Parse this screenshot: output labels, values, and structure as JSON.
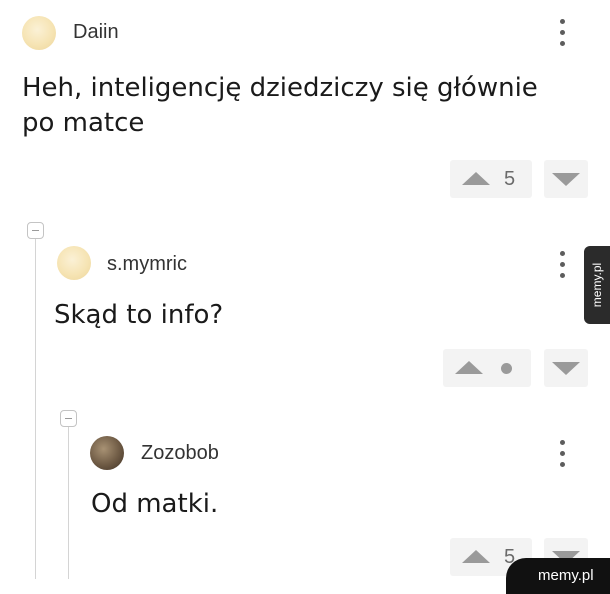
{
  "comments": [
    {
      "username": "Daiin",
      "avatar": "avatar-light",
      "text_lines": [
        "Heh, inteligencję dziedziczy się głównie",
        "po matce"
      ],
      "score": "5"
    },
    {
      "username": "s.mymric",
      "avatar": "avatar-light",
      "text_lines": [
        "Skąd to info?"
      ],
      "score": "",
      "score_indicator": "dot"
    },
    {
      "username": "Zozobob",
      "avatar": "avatar-dark",
      "text_lines": [
        "Od matki."
      ],
      "score": "5"
    }
  ],
  "icons": {
    "menu": "kebab-menu-icon",
    "upvote": "triangle-up-icon",
    "downvote": "triangle-down-icon",
    "collapse": "collapse-minus-icon"
  },
  "colors": {
    "background": "#ffffff",
    "vote_box": "#f3f3f3",
    "vote_icon": "#9a9a9a",
    "thread_line": "#d4d4d4",
    "watermark": "#111111"
  },
  "watermark": {
    "side_text": "memy.pl",
    "corner_text": "memy.pl"
  }
}
